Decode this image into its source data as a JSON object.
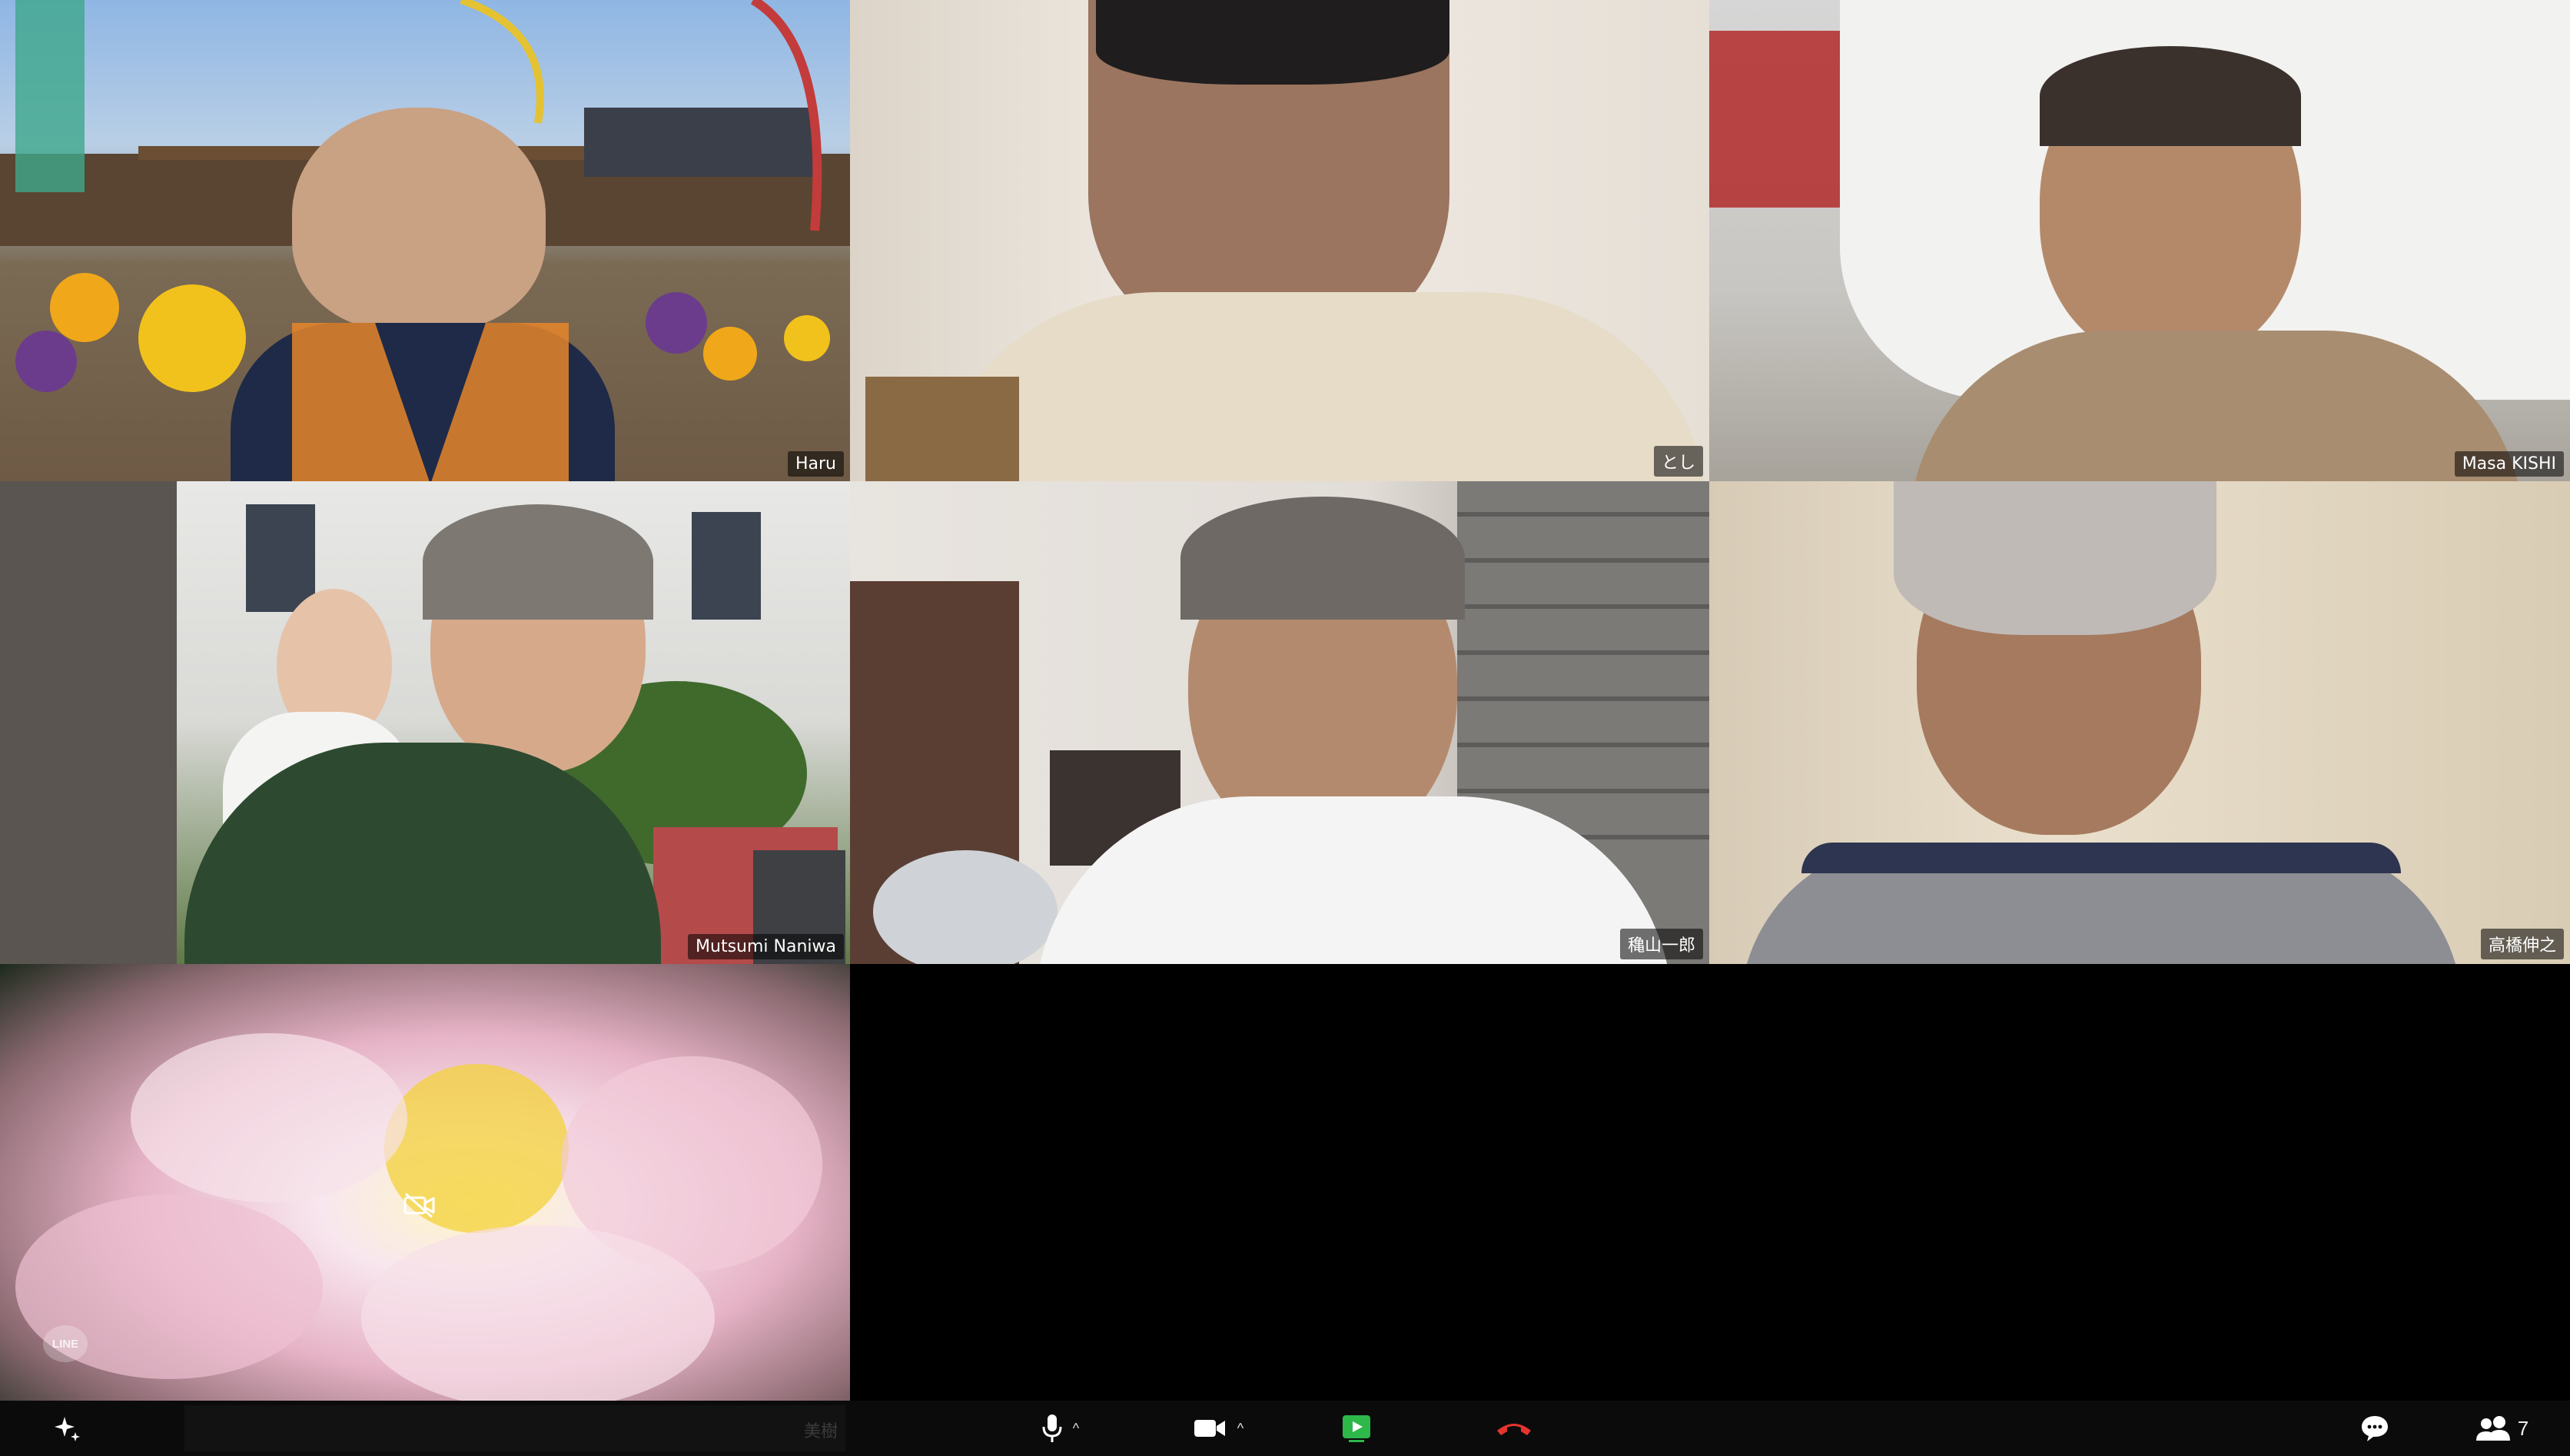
{
  "participants": [
    {
      "name": "Haru"
    },
    {
      "name": "とし"
    },
    {
      "name": "Masa KISHI"
    },
    {
      "name": "Mutsumi Naniwa"
    },
    {
      "name": "穐山一郎"
    },
    {
      "name": "高橋伸之"
    },
    {
      "name": "美樹",
      "video_off": true
    }
  ],
  "toolbar": {
    "participants_count": "7",
    "self_view_label": "美樹",
    "line_badge": "LINE"
  },
  "icons": {
    "effects": "sparkle-icon",
    "mic": "microphone-icon",
    "video": "video-camera-icon",
    "share": "share-screen-icon",
    "end": "end-call-icon",
    "chat": "chat-icon",
    "participants": "participants-icon",
    "video_off": "video-off-icon"
  },
  "colors": {
    "share_green": "#2db84a",
    "end_red": "#e5342e",
    "background": "#000000"
  }
}
